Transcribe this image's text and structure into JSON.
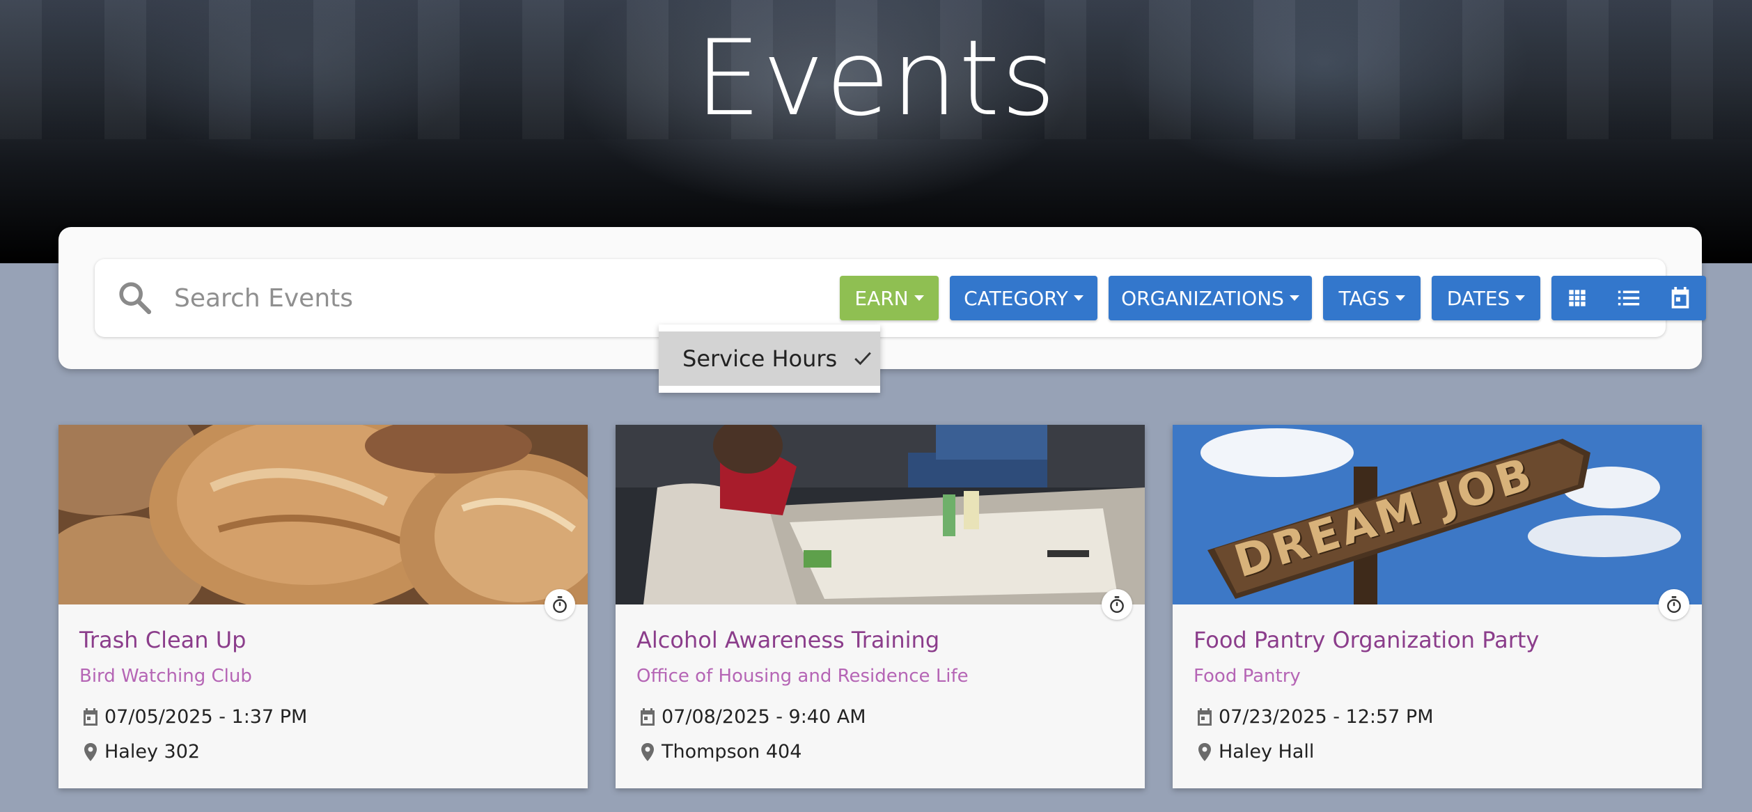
{
  "hero": {
    "title": "Events"
  },
  "search": {
    "placeholder": "Search Events",
    "value": ""
  },
  "filters": {
    "earn_label": "EARN",
    "category_label": "CATEGORY",
    "organizations_label": "ORGANIZATIONS",
    "tags_label": "TAGS",
    "dates_label": "DATES"
  },
  "view_toggle": {
    "icons": [
      "grid-view-icon",
      "list-view-icon",
      "calendar-view-icon"
    ]
  },
  "earn_dropdown": {
    "items": [
      {
        "label": "Service Hours",
        "selected": true
      }
    ]
  },
  "events": [
    {
      "title": "Trash Clean Up",
      "organization": "Bird Watching Club",
      "datetime": "07/05/2025 - 1:37 PM",
      "location": "Haley 302",
      "image": "bread"
    },
    {
      "title": "Alcohol Awareness Training",
      "organization": "Office of Housing and Residence Life",
      "datetime": "07/08/2025 - 9:40 AM",
      "location": "Thompson 404",
      "image": "meeting-table"
    },
    {
      "title": "Food Pantry Organization Party",
      "organization": "Food Pantry",
      "datetime": "07/23/2025 - 12:57 PM",
      "location": "Haley Hall",
      "image": "dream-job-sign"
    }
  ],
  "colors": {
    "earn_button": "#8fbf52",
    "filter_button": "#3377cc",
    "event_title": "#8b3d8b",
    "event_org": "#b565b5",
    "page_background": "#97a2b6"
  }
}
